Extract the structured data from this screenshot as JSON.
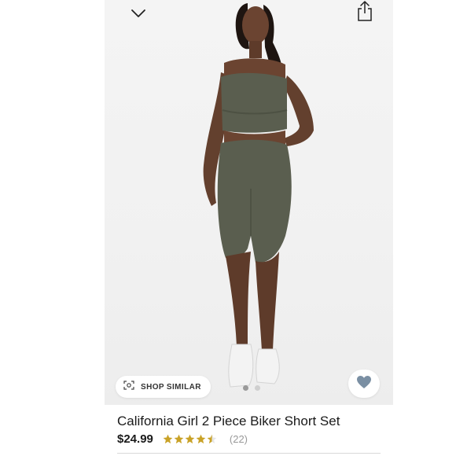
{
  "product": {
    "title": "California Girl 2 Piece Biker Short Set",
    "price": "$24.99",
    "rating": 4.5,
    "review_count": "(22)",
    "image_count": 2,
    "current_image_index": 0
  },
  "actions": {
    "shop_similar_label": "SHOP SIMILAR"
  },
  "icons": {
    "back": "chevron-down-icon",
    "share": "share-icon",
    "favorite": "heart-icon",
    "shop_similar": "camera-scan-icon"
  },
  "colors": {
    "star": "#c9a227",
    "heart": "#7a8fa3",
    "outfit": "#5a5e4f"
  }
}
